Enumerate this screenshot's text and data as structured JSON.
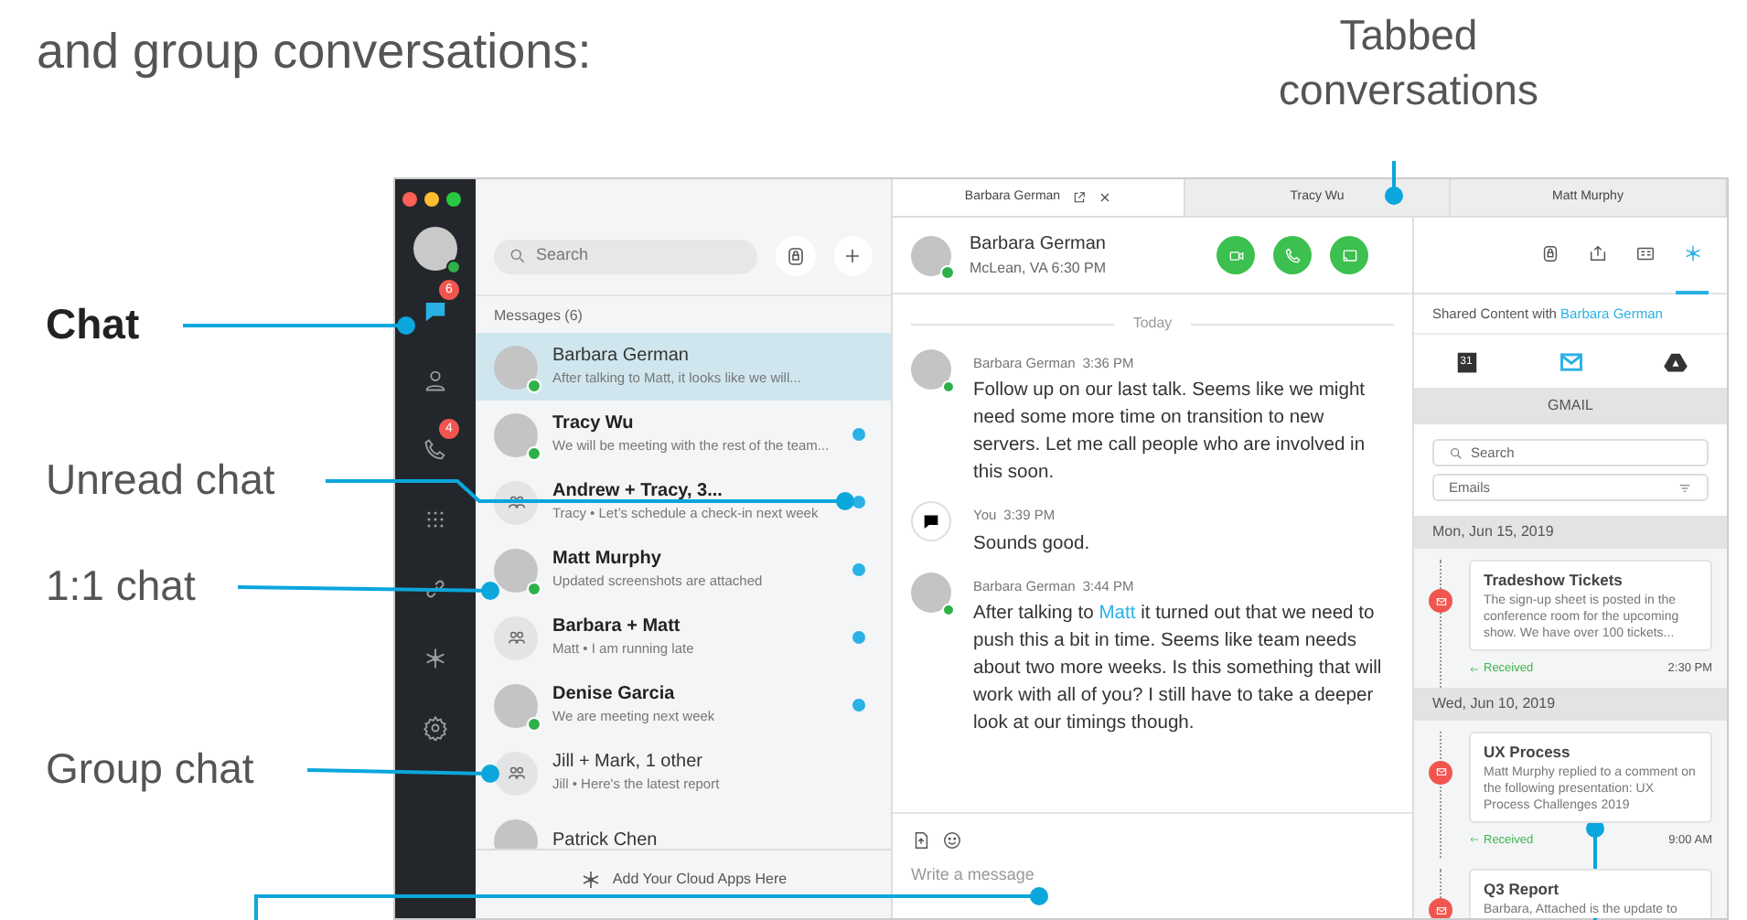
{
  "heading": "and group conversations:",
  "callouts": [
    {
      "label": "Tabbed conversations",
      "bold": false
    },
    {
      "label": "Chat",
      "bold": true
    },
    {
      "label": "Unread chat",
      "bold": false
    },
    {
      "label": "1:1 chat",
      "bold": false
    },
    {
      "label": "Group chat",
      "bold": false
    }
  ],
  "sidebar": {
    "items": [
      {
        "badge": "6",
        "selected": true
      },
      {
        "selected": false
      },
      {
        "badge": "4",
        "selected": false
      },
      {
        "selected": false
      },
      {
        "selected": false
      },
      {
        "selected": false
      },
      {
        "selected": false
      }
    ]
  },
  "chat_list": {
    "search_placeholder": "Search",
    "section": "Messages (6)",
    "items": [
      {
        "kind": "person",
        "name": "Barbara German",
        "preview": "After talking to Matt, it looks like we will...",
        "selected": true,
        "unread": false,
        "online": true
      },
      {
        "kind": "person",
        "name": "Tracy Wu",
        "preview": "We will be meeting with the rest of the team...",
        "selected": false,
        "unread": true,
        "online": true
      },
      {
        "kind": "group",
        "name": "Andrew + Tracy, 3...",
        "preview": "Tracy • Let’s schedule a check-in next week",
        "selected": false,
        "unread": true,
        "online": false
      },
      {
        "kind": "person",
        "name": "Matt Murphy",
        "preview": "Updated screenshots are attached",
        "selected": false,
        "unread": true,
        "online": true
      },
      {
        "kind": "group",
        "name": "Barbara + Matt",
        "preview": "Matt • I am running late",
        "selected": false,
        "unread": true,
        "online": false
      },
      {
        "kind": "person",
        "name": "Denise Garcia",
        "preview": "We are meeting next week",
        "selected": false,
        "unread": true,
        "online": true
      },
      {
        "kind": "group",
        "name": "Jill + Mark, 1 other",
        "preview": "Jill • Here's the latest report",
        "selected": false,
        "unread": false,
        "online": false
      },
      {
        "kind": "person",
        "name": "Patrick Chen",
        "selected": false,
        "unread": false,
        "online": false
      }
    ],
    "footer": "Add Your Cloud Apps Here"
  },
  "tabs": [
    {
      "label": "Barbara German",
      "selected": true
    },
    {
      "label": "Tracy Wu",
      "selected": false
    },
    {
      "label": "Matt Murphy",
      "selected": false
    }
  ],
  "conversation": {
    "name": "Barbara German",
    "location": "McLean, VA 6:30 PM",
    "day": "Today",
    "messages": [
      {
        "kind": "contact",
        "sender": "Barbara German",
        "time": "3:36 PM",
        "parts": [
          {
            "kind": "plain",
            "text": "Follow up on our last talk. Seems like we might need some more time on transition to new servers. Let me call people who are involved in this soon."
          }
        ]
      },
      {
        "kind": "self",
        "sender": "You",
        "time": "3:39 PM",
        "parts": [
          {
            "kind": "plain",
            "text": "Sounds good."
          }
        ]
      },
      {
        "kind": "contact",
        "sender": "Barbara German",
        "time": "3:44 PM",
        "parts": [
          {
            "kind": "plain",
            "text": "After talking to "
          },
          {
            "kind": "mention",
            "text": "Matt"
          },
          {
            "kind": "plain",
            "text": " it turned out that we need to push this a bit in time. Seems like team needs about two more weeks. Is this something that will work with all of you? I still have to take a deeper look at our timings though."
          }
        ]
      }
    ],
    "composer_placeholder": "Write a message"
  },
  "side_panel": {
    "header_icons": [
      {
        "selected": false
      },
      {
        "selected": false
      },
      {
        "selected": false
      },
      {
        "selected": true
      }
    ],
    "shared_with": "Shared Content with ",
    "contact": "Barbara German",
    "apps": [
      {
        "label": "31",
        "selected": false
      },
      {
        "selected": true
      },
      {
        "selected": false
      }
    ],
    "app_title": "GMAIL",
    "search_placeholder": "Search",
    "filter": "Emails",
    "groups": [
      {
        "date": "Mon, Jun 15, 2019",
        "emails": [
          {
            "subject": "Tradeshow Tickets",
            "body": "The sign-up sheet is posted in the conference room for the upcoming show. We have over 100 tickets...",
            "status": "Received",
            "time": "2:30 PM"
          }
        ]
      },
      {
        "date": "Wed, Jun 10, 2019",
        "emails": [
          {
            "subject": "UX Process",
            "body": "Matt Murphy replied to a comment on the following presentation: UX Process Challenges 2019",
            "status": "Received",
            "time": "9:00 AM"
          },
          {
            "subject": "Q3 Report",
            "body": "Barbara, Attached is the update to"
          }
        ]
      }
    ]
  }
}
